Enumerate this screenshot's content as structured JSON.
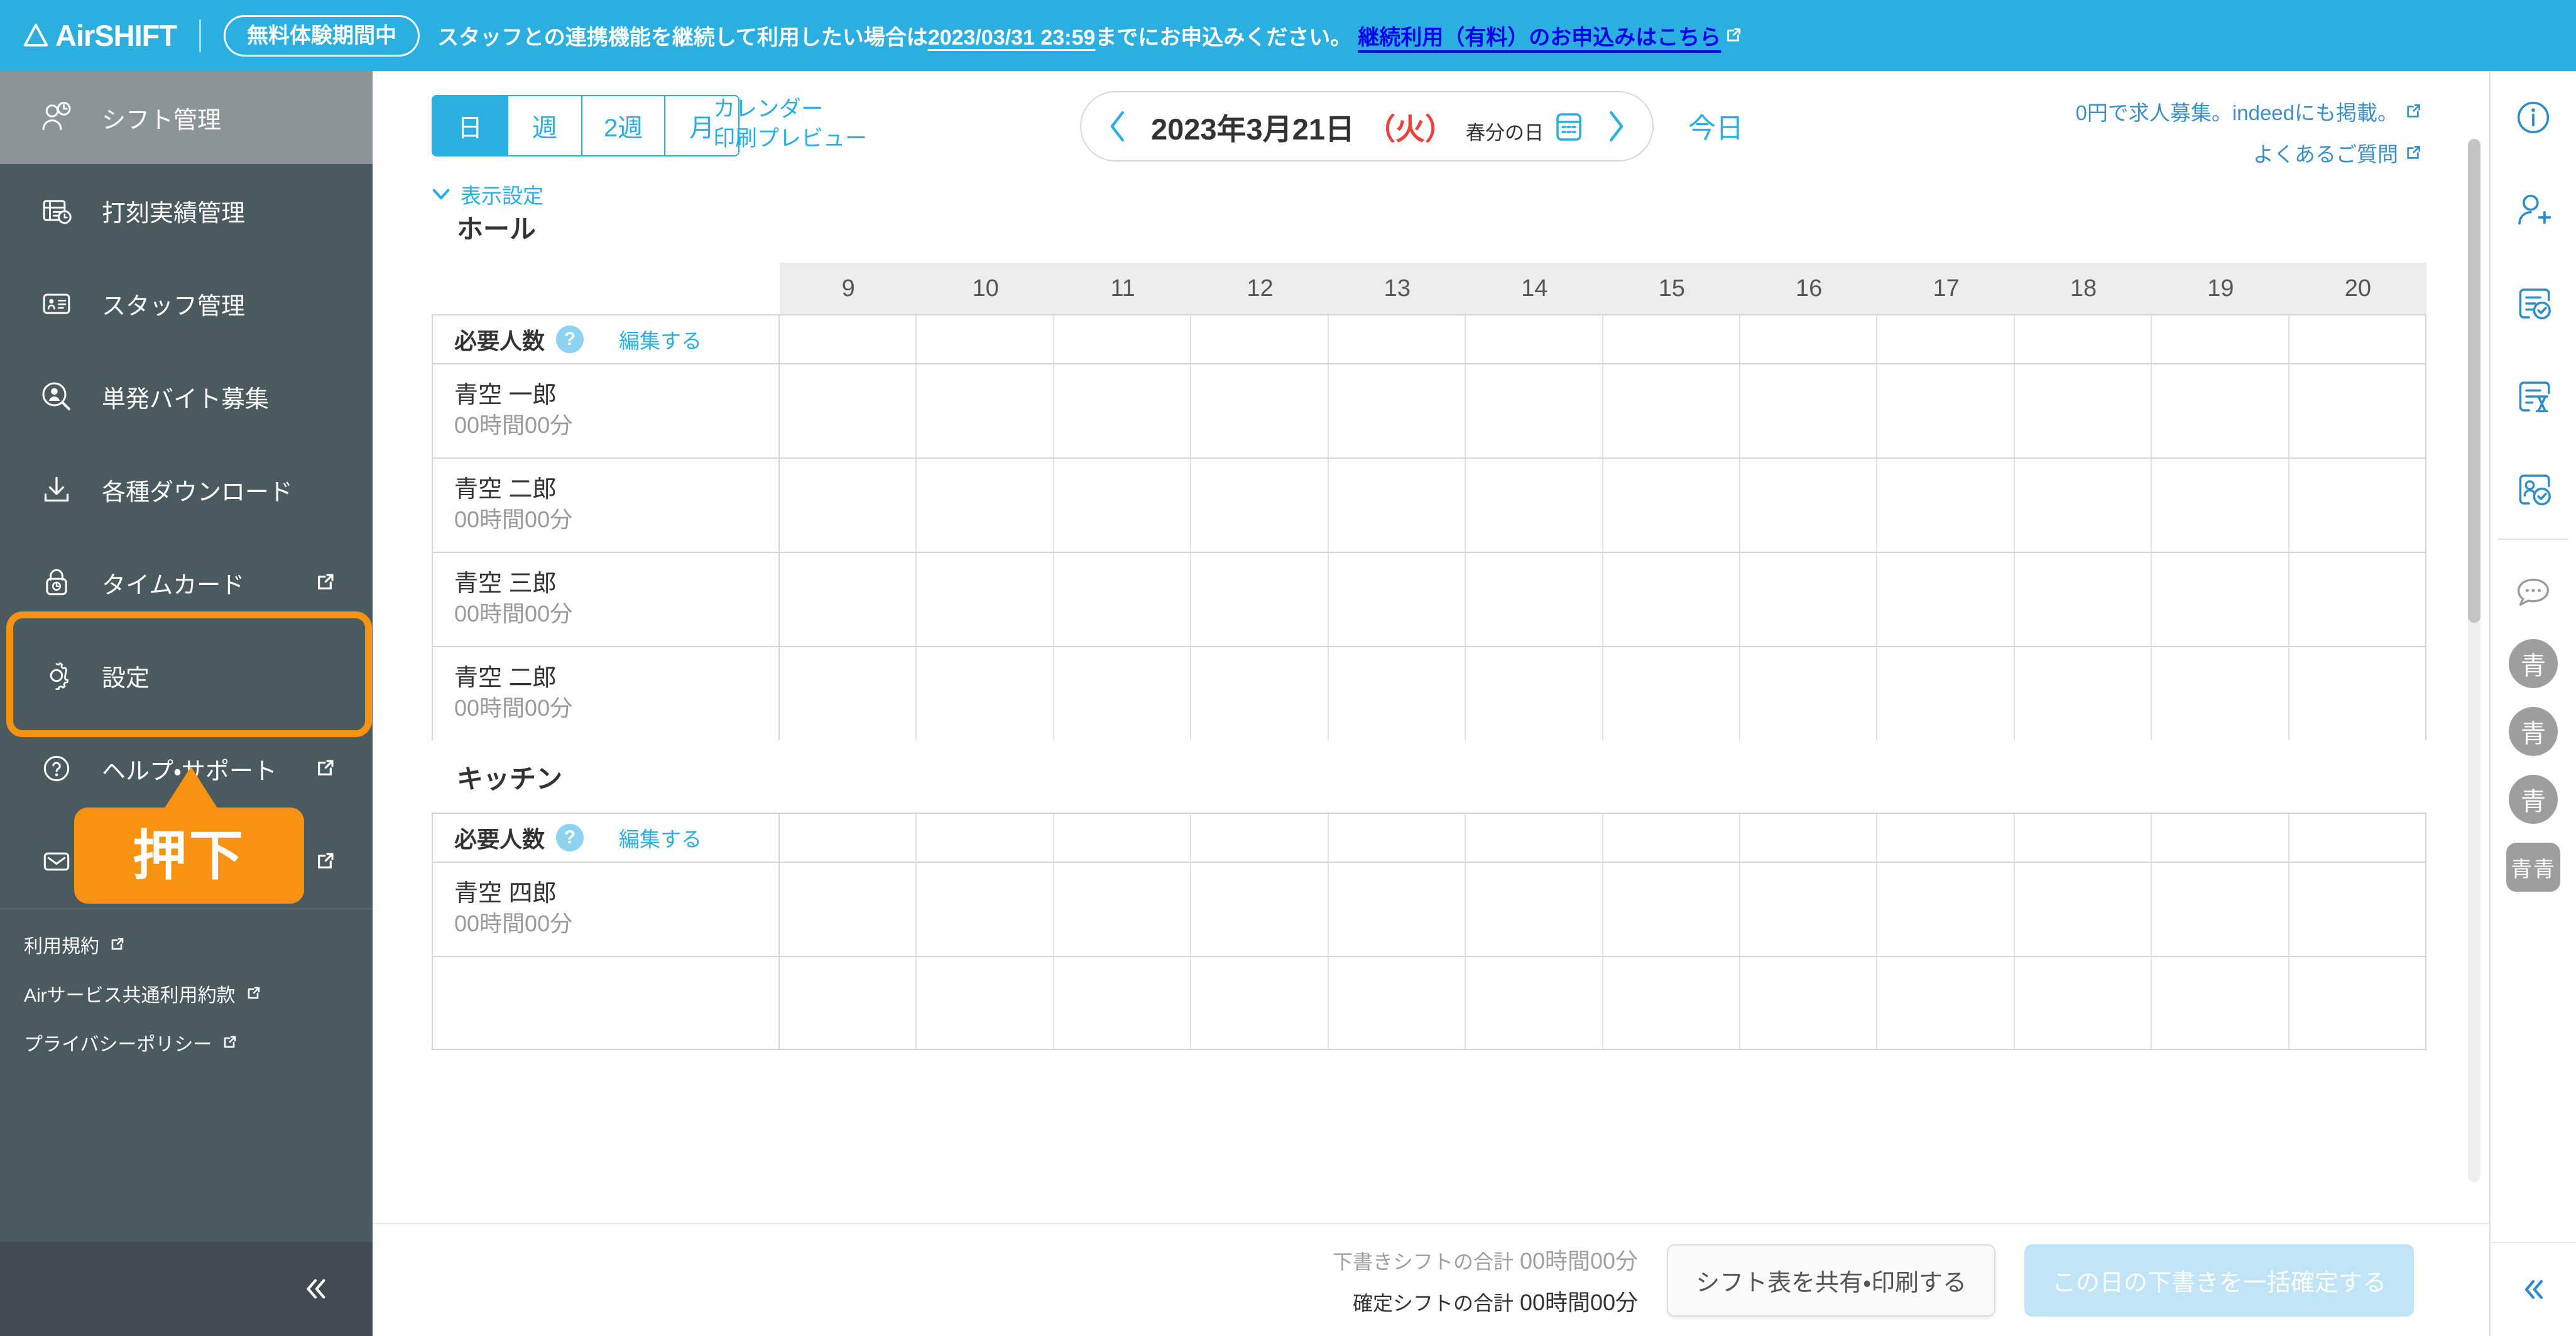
{
  "banner": {
    "brand": "AirSHIFT",
    "trial_badge": "無料体験期間中",
    "message_prefix": "スタッフとの連携機能を継続して利用したい場合は",
    "deadline": "2023/03/31 23:59",
    "message_suffix": "までにお申込みください。",
    "cta": "継続利用（有料）のお申込みはこちら"
  },
  "sidebar": {
    "items": [
      {
        "label": "シフト管理",
        "icon": "user-clock-icon",
        "external": false,
        "active": true
      },
      {
        "label": "打刻実績管理",
        "icon": "timesheet-clock-icon",
        "external": false,
        "active": false
      },
      {
        "label": "スタッフ管理",
        "icon": "id-card-icon",
        "external": false,
        "active": false
      },
      {
        "label": "単発バイト募集",
        "icon": "user-search-icon",
        "external": false,
        "active": false
      },
      {
        "label": "各種ダウンロード",
        "icon": "download-icon",
        "external": false,
        "active": false
      },
      {
        "label": "タイムカード",
        "icon": "lock-clock-icon",
        "external": true,
        "active": false
      },
      {
        "label": "設定",
        "icon": "gear-icon",
        "external": false,
        "active": false
      },
      {
        "label": "ヘルプ・サポート",
        "icon": "question-circle-icon",
        "external": true,
        "active": false
      },
      {
        "label": "お問い合わせ",
        "icon": "mail-icon",
        "external": true,
        "active": false
      }
    ],
    "legal_links": [
      {
        "label": "利用規約"
      },
      {
        "label": "Airサービス共通利用約款"
      },
      {
        "label": "プライバシーポリシー"
      }
    ],
    "collapse_icon": "chevron-double-left-icon"
  },
  "callout": {
    "text": "押下",
    "color": "#F79310",
    "target_item": "設定"
  },
  "toolbar": {
    "view_tabs": [
      {
        "label": "日",
        "selected": true
      },
      {
        "label": "週",
        "selected": false
      },
      {
        "label": "2週",
        "selected": false
      },
      {
        "label": "月",
        "selected": false
      }
    ],
    "calendar_print_line1": "カレンダー",
    "calendar_print_line2": "印刷プレビュー",
    "display_settings": "表示設定",
    "date": {
      "main": "2023年3月21日",
      "dow": "（火）",
      "holiday": "春分の日",
      "prev_icon": "chevron-left-icon",
      "next_icon": "chevron-right-icon",
      "calendar_icon": "calendar-icon"
    },
    "today": "今日",
    "right_links": [
      {
        "label": "0円で求人募集。indeedにも掲載。"
      },
      {
        "label": "よくあるご質問"
      }
    ]
  },
  "schedule": {
    "hours": [
      "9",
      "10",
      "11",
      "12",
      "13",
      "14",
      "15",
      "16",
      "17",
      "18",
      "19",
      "20"
    ],
    "required_label": "必要人数",
    "required_help": "?",
    "edit_label": "編集する",
    "groups": [
      {
        "name": "ホール",
        "staff": [
          {
            "name": "青空 一郎",
            "hours": "00時間00分"
          },
          {
            "name": "青空 二郎",
            "hours": "00時間00分"
          },
          {
            "name": "青空 三郎",
            "hours": "00時間00分"
          },
          {
            "name": "青空 二郎",
            "hours": "00時間00分"
          }
        ]
      },
      {
        "name": "キッチン",
        "staff": [
          {
            "name": "青空 四郎",
            "hours": "00時間00分"
          }
        ]
      }
    ]
  },
  "bottom": {
    "draft_label": "下書きシフトの合計",
    "draft_value": "00時間00分",
    "fixed_label": "確定シフトの合計",
    "fixed_value": "00時間00分",
    "share_button": "シフト表を共有・印刷する",
    "confirm_button": "この日の下書きを一括確定する"
  },
  "rail": {
    "icons": [
      {
        "name": "info-icon"
      },
      {
        "name": "add-user-icon"
      },
      {
        "name": "request-approved-icon"
      },
      {
        "name": "request-pending-icon"
      },
      {
        "name": "staff-approved-icon"
      },
      {
        "name": "chat-icon"
      }
    ],
    "avatars": [
      {
        "initial": "青",
        "group": false
      },
      {
        "initial": "青",
        "group": false
      },
      {
        "initial": "青",
        "group": false
      },
      {
        "initial": "青青",
        "group": true
      }
    ],
    "collapse_icon": "chevron-double-left-icon"
  },
  "colors": {
    "brand_blue": "#2BAEE0",
    "sidebar_bg": "#4A5A5F",
    "highlight_orange": "#F79310",
    "holiday_red": "#E8443A"
  }
}
